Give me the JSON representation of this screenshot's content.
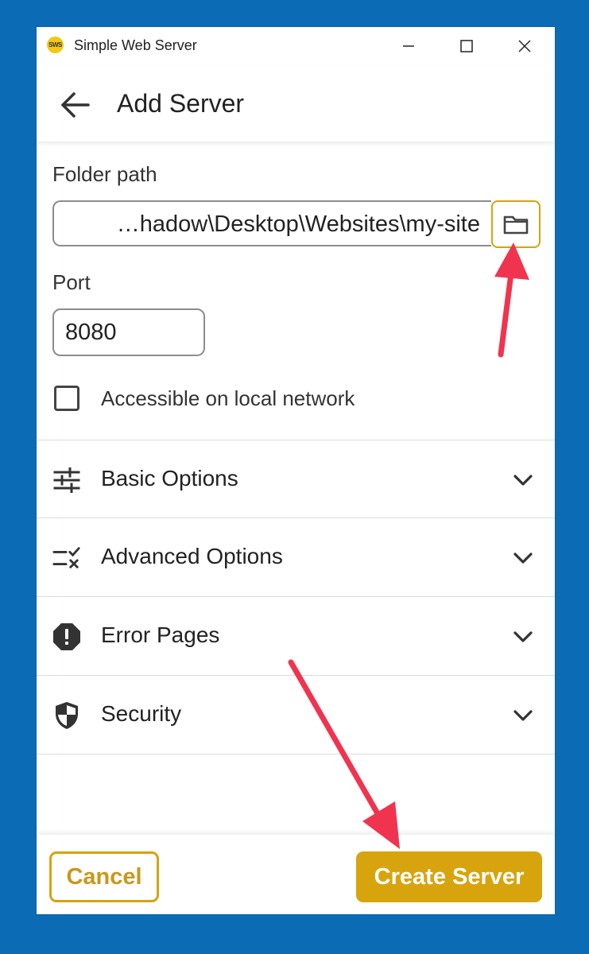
{
  "window": {
    "title": "Simple Web Server",
    "logo_text": "SWS",
    "controls": [
      "minimize-icon",
      "maximize-icon",
      "close-icon"
    ]
  },
  "header": {
    "title": "Add Server",
    "back_icon": "arrow-left-icon"
  },
  "form": {
    "folder_path_label": "Folder path",
    "folder_path_value": "…hadow\\Desktop\\Websites\\my-site",
    "folder_button_icon": "folder-icon",
    "port_label": "Port",
    "port_value": "8080",
    "local_network_label": "Accessible on local network",
    "local_network_checked": false
  },
  "sections": [
    {
      "label": "Basic Options",
      "icon": "sliders-icon"
    },
    {
      "label": "Advanced Options",
      "icon": "checklist-icon"
    },
    {
      "label": "Error Pages",
      "icon": "alert-octagon-icon"
    },
    {
      "label": "Security",
      "icon": "shield-icon"
    }
  ],
  "footer": {
    "cancel_label": "Cancel",
    "create_label": "Create Server"
  },
  "colors": {
    "accent": "#d8a40e",
    "background": "#0b6bb5",
    "annotation_arrow": "#f0344f"
  }
}
